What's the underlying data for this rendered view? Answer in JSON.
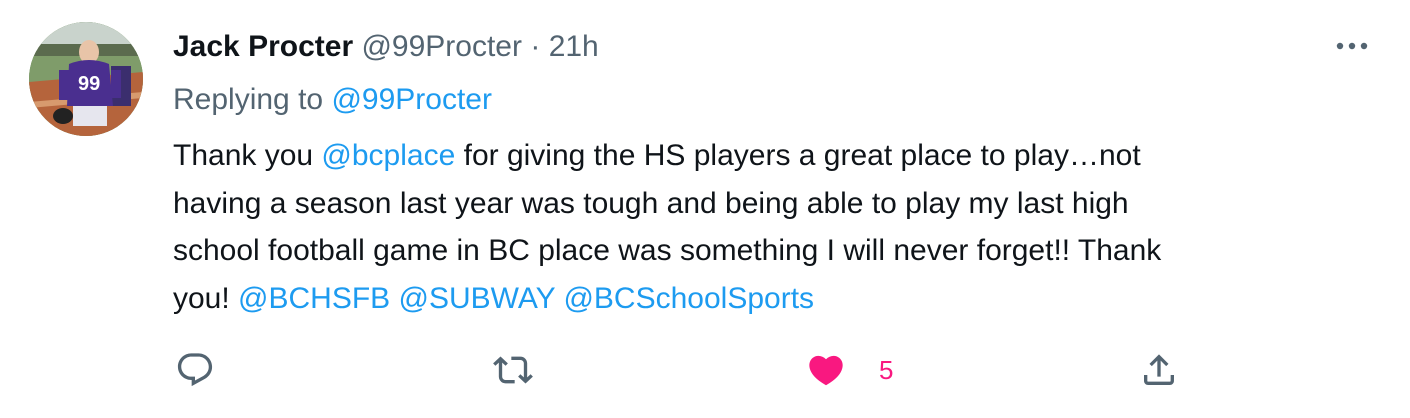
{
  "tweet": {
    "author": {
      "display_name": "Jack Procter",
      "handle": "@99Procter",
      "avatar_jersey_number": "99"
    },
    "separator": "·",
    "time": "21h",
    "replying_label": "Replying to ",
    "replying_to": "@99Procter",
    "text": {
      "l1_a": "Thank you ",
      "l1_mention": "@bcplace",
      "l1_b": " for giving the HS players a great place to play…not",
      "l2": "having a season last year was tough and being able to play my last high",
      "l3": "school football game in BC place was something I will never forget!! Thank",
      "l4_a": "you!  ",
      "mentions": [
        "@BCHSFB",
        "@SUBWAY",
        "@BCSchoolSports"
      ]
    },
    "actions": {
      "reply_icon": "reply-icon",
      "retweet_icon": "retweet-icon",
      "like_icon": "heart-icon",
      "share_icon": "share-icon",
      "like_count": "5",
      "liked": true
    },
    "colors": {
      "link": "#1d9bf0",
      "like": "#f91880",
      "muted": "#536471",
      "text": "#0f1419"
    }
  }
}
